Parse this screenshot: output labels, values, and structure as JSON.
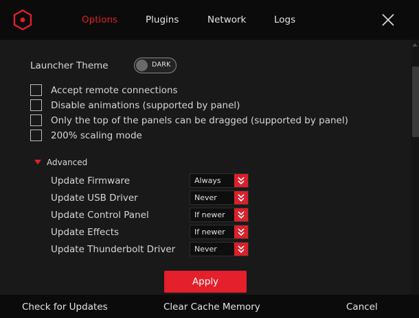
{
  "nav": {
    "tabs": [
      {
        "label": "Options",
        "active": true
      },
      {
        "label": "Plugins",
        "active": false
      },
      {
        "label": "Network",
        "active": false
      },
      {
        "label": "Logs",
        "active": false
      }
    ]
  },
  "theme": {
    "label": "Launcher Theme",
    "value": "DARK"
  },
  "checkboxes": [
    {
      "label": "Accept remote connections",
      "checked": false
    },
    {
      "label": "Disable animations (supported by panel)",
      "checked": false
    },
    {
      "label": "Only the top of the panels can be dragged (supported by panel)",
      "checked": false
    },
    {
      "label": "200% scaling mode",
      "checked": false
    }
  ],
  "advanced": {
    "label": "Advanced",
    "expanded": true,
    "updates": [
      {
        "label": "Update Firmware",
        "value": "Always"
      },
      {
        "label": "Update USB Driver",
        "value": "Never"
      },
      {
        "label": "Update Control Panel",
        "value": "If newer"
      },
      {
        "label": "Update Effects",
        "value": "If newer"
      },
      {
        "label": "Update Thunderbolt Driver",
        "value": "Never"
      }
    ]
  },
  "apply_label": "Apply",
  "footer": {
    "check_updates": "Check for Updates",
    "clear_cache": "Clear Cache Memory",
    "cancel": "Cancel"
  },
  "icons": {
    "logo": "hexagon-logo-icon",
    "close": "close-icon",
    "caret": "caret-down-icon",
    "select_arrow": "double-chevron-down-icon"
  },
  "colors": {
    "accent": "#e3202b",
    "background": "#191919",
    "header": "#0b0b0b",
    "text": "#d6d6d6"
  }
}
